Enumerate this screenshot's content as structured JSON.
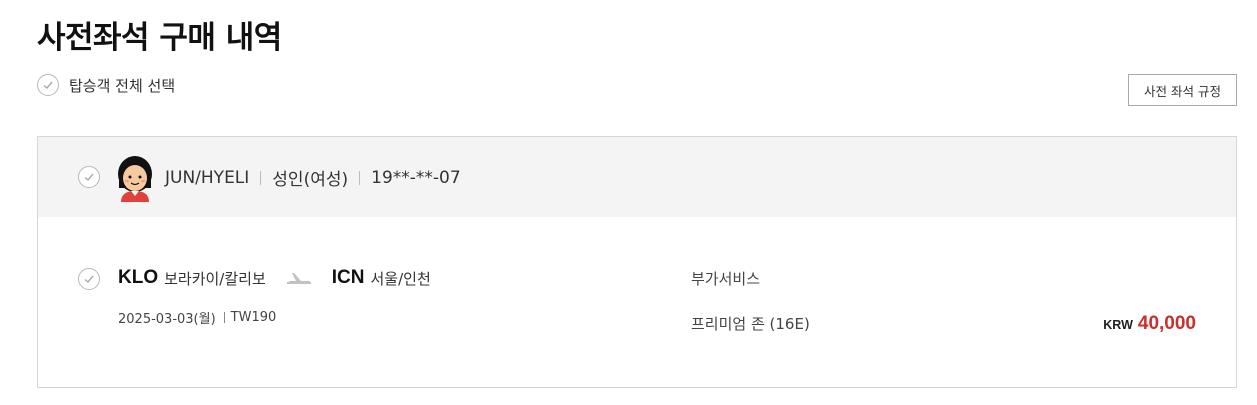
{
  "page": {
    "title": "사전좌석 구매 내역"
  },
  "select_all": {
    "label": "탑승객 전체 선택"
  },
  "rules_button": {
    "label": "사전 좌석 규정"
  },
  "passenger": {
    "name": "JUN/HYELI",
    "type": "성인(여성)",
    "birth": "19**-**-07"
  },
  "flight": {
    "departure_code": "KLO",
    "departure_city": "보라카이/칼리보",
    "arrival_code": "ICN",
    "arrival_city": "서울/인천",
    "date": "2025-03-03(월)",
    "flight_no": "TW190"
  },
  "service": {
    "type": "부가서비스",
    "detail": "프리미엄 존 (16E)"
  },
  "price": {
    "currency": "KRW",
    "amount": "40,000"
  },
  "colors": {
    "price": "#c9302c",
    "row_bg": "#f4f4f4",
    "border": "#d6d6d6"
  },
  "icons": [
    "check-circle-icon",
    "passenger-avatar-icon",
    "airplane-icon"
  ]
}
